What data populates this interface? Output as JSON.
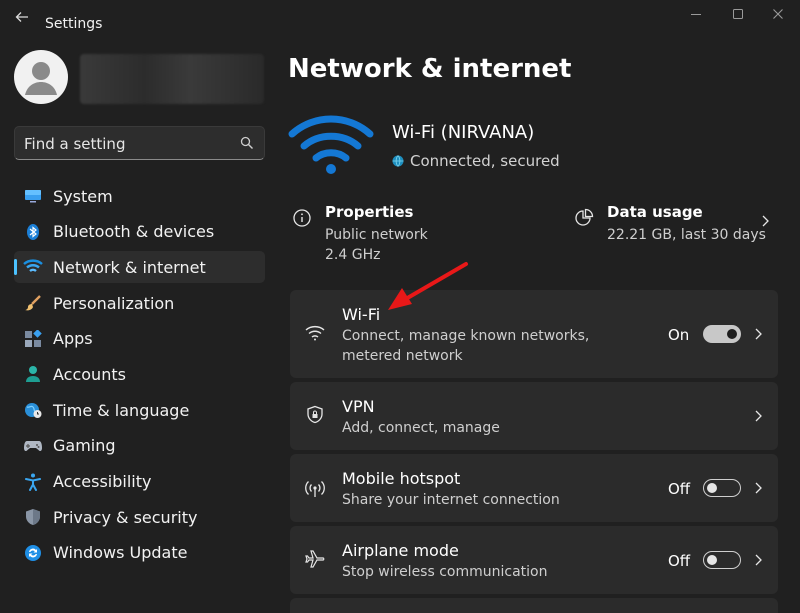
{
  "titlebar": {
    "title": "Settings"
  },
  "sidebar": {
    "search_placeholder": "Find a setting",
    "items": [
      {
        "label": "System",
        "icon": "system-icon"
      },
      {
        "label": "Bluetooth & devices",
        "icon": "bluetooth-icon"
      },
      {
        "label": "Network & internet",
        "icon": "network-icon",
        "active": true
      },
      {
        "label": "Personalization",
        "icon": "brush-icon"
      },
      {
        "label": "Apps",
        "icon": "apps-icon"
      },
      {
        "label": "Accounts",
        "icon": "accounts-icon"
      },
      {
        "label": "Time & language",
        "icon": "time-language-icon"
      },
      {
        "label": "Gaming",
        "icon": "gaming-icon"
      },
      {
        "label": "Accessibility",
        "icon": "accessibility-icon"
      },
      {
        "label": "Privacy & security",
        "icon": "shield-icon"
      },
      {
        "label": "Windows Update",
        "icon": "windows-update-icon"
      }
    ]
  },
  "main": {
    "title": "Network & internet",
    "hero": {
      "name": "Wi-Fi (NIRVANA)",
      "status": "Connected, secured"
    },
    "properties": {
      "title": "Properties",
      "line1": "Public network",
      "line2": "2.4 GHz"
    },
    "data_usage": {
      "title": "Data usage",
      "line1": "22.21 GB, last 30 days"
    },
    "cards": {
      "wifi": {
        "title": "Wi-Fi",
        "subtitle": "Connect, manage known networks, metered network",
        "toggle_label": "On"
      },
      "vpn": {
        "title": "VPN",
        "subtitle": "Add, connect, manage"
      },
      "hotspot": {
        "title": "Mobile hotspot",
        "subtitle": "Share your internet connection",
        "toggle_label": "Off"
      },
      "airplane": {
        "title": "Airplane mode",
        "subtitle": "Stop wireless communication",
        "toggle_label": "Off"
      }
    }
  },
  "colors": {
    "accent": "#4cc2ff",
    "wifi_blue": "#0f7ddc",
    "annotation_red": "#e81818"
  }
}
